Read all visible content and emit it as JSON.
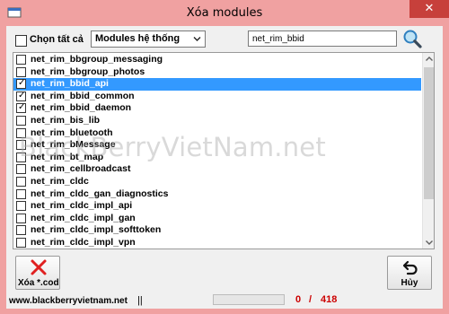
{
  "window": {
    "title": "Xóa modules",
    "close_glyph": "✕",
    "titlebar_color": "#f0a1a1",
    "close_color": "#c7403b"
  },
  "toolbar": {
    "select_all_label": "Chọn tất cả",
    "select_all_checked": false,
    "module_type_selected": "Modules hệ thống",
    "search_value": "net_rim_bbid",
    "search_icon": "magnifier-icon"
  },
  "list": {
    "selection_color": "#3399ff",
    "items": [
      {
        "label": "net_rim_bbgroup_messaging",
        "checked": false,
        "selected": false
      },
      {
        "label": "net_rim_bbgroup_photos",
        "checked": false,
        "selected": false
      },
      {
        "label": "net_rim_bbid_api",
        "checked": true,
        "selected": true
      },
      {
        "label": "net_rim_bbid_common",
        "checked": true,
        "selected": false
      },
      {
        "label": "net_rim_bbid_daemon",
        "checked": true,
        "selected": false
      },
      {
        "label": "net_rim_bis_lib",
        "checked": false,
        "selected": false
      },
      {
        "label": "net_rim_bluetooth",
        "checked": false,
        "selected": false
      },
      {
        "label": "net_rim_bMessage",
        "checked": false,
        "selected": false
      },
      {
        "label": "net_rim_bt_map",
        "checked": false,
        "selected": false
      },
      {
        "label": "net_rim_cellbroadcast",
        "checked": false,
        "selected": false
      },
      {
        "label": "net_rim_cldc",
        "checked": false,
        "selected": false
      },
      {
        "label": "net_rim_cldc_gan_diagnostics",
        "checked": false,
        "selected": false
      },
      {
        "label": "net_rim_cldc_impl_api",
        "checked": false,
        "selected": false
      },
      {
        "label": "net_rim_cldc_impl_gan",
        "checked": false,
        "selected": false
      },
      {
        "label": "net_rim_cldc_impl_softtoken",
        "checked": false,
        "selected": false
      },
      {
        "label": "net_rim_cldc_impl_vpn",
        "checked": false,
        "selected": false
      }
    ]
  },
  "watermark": "BlackBerryVietNam.net",
  "buttons": {
    "delete_label": "Xóa   *.cod",
    "delete_icon": "red-x-icon",
    "cancel_label": "Hủy",
    "cancel_icon": "undo-arrow-icon"
  },
  "status": {
    "website": "www.blackberryvietnam.net",
    "separator": "||",
    "progress_fraction": 0,
    "current_count": "0",
    "count_separator": "/",
    "total_count": "418",
    "count_color": "#cc0000"
  }
}
